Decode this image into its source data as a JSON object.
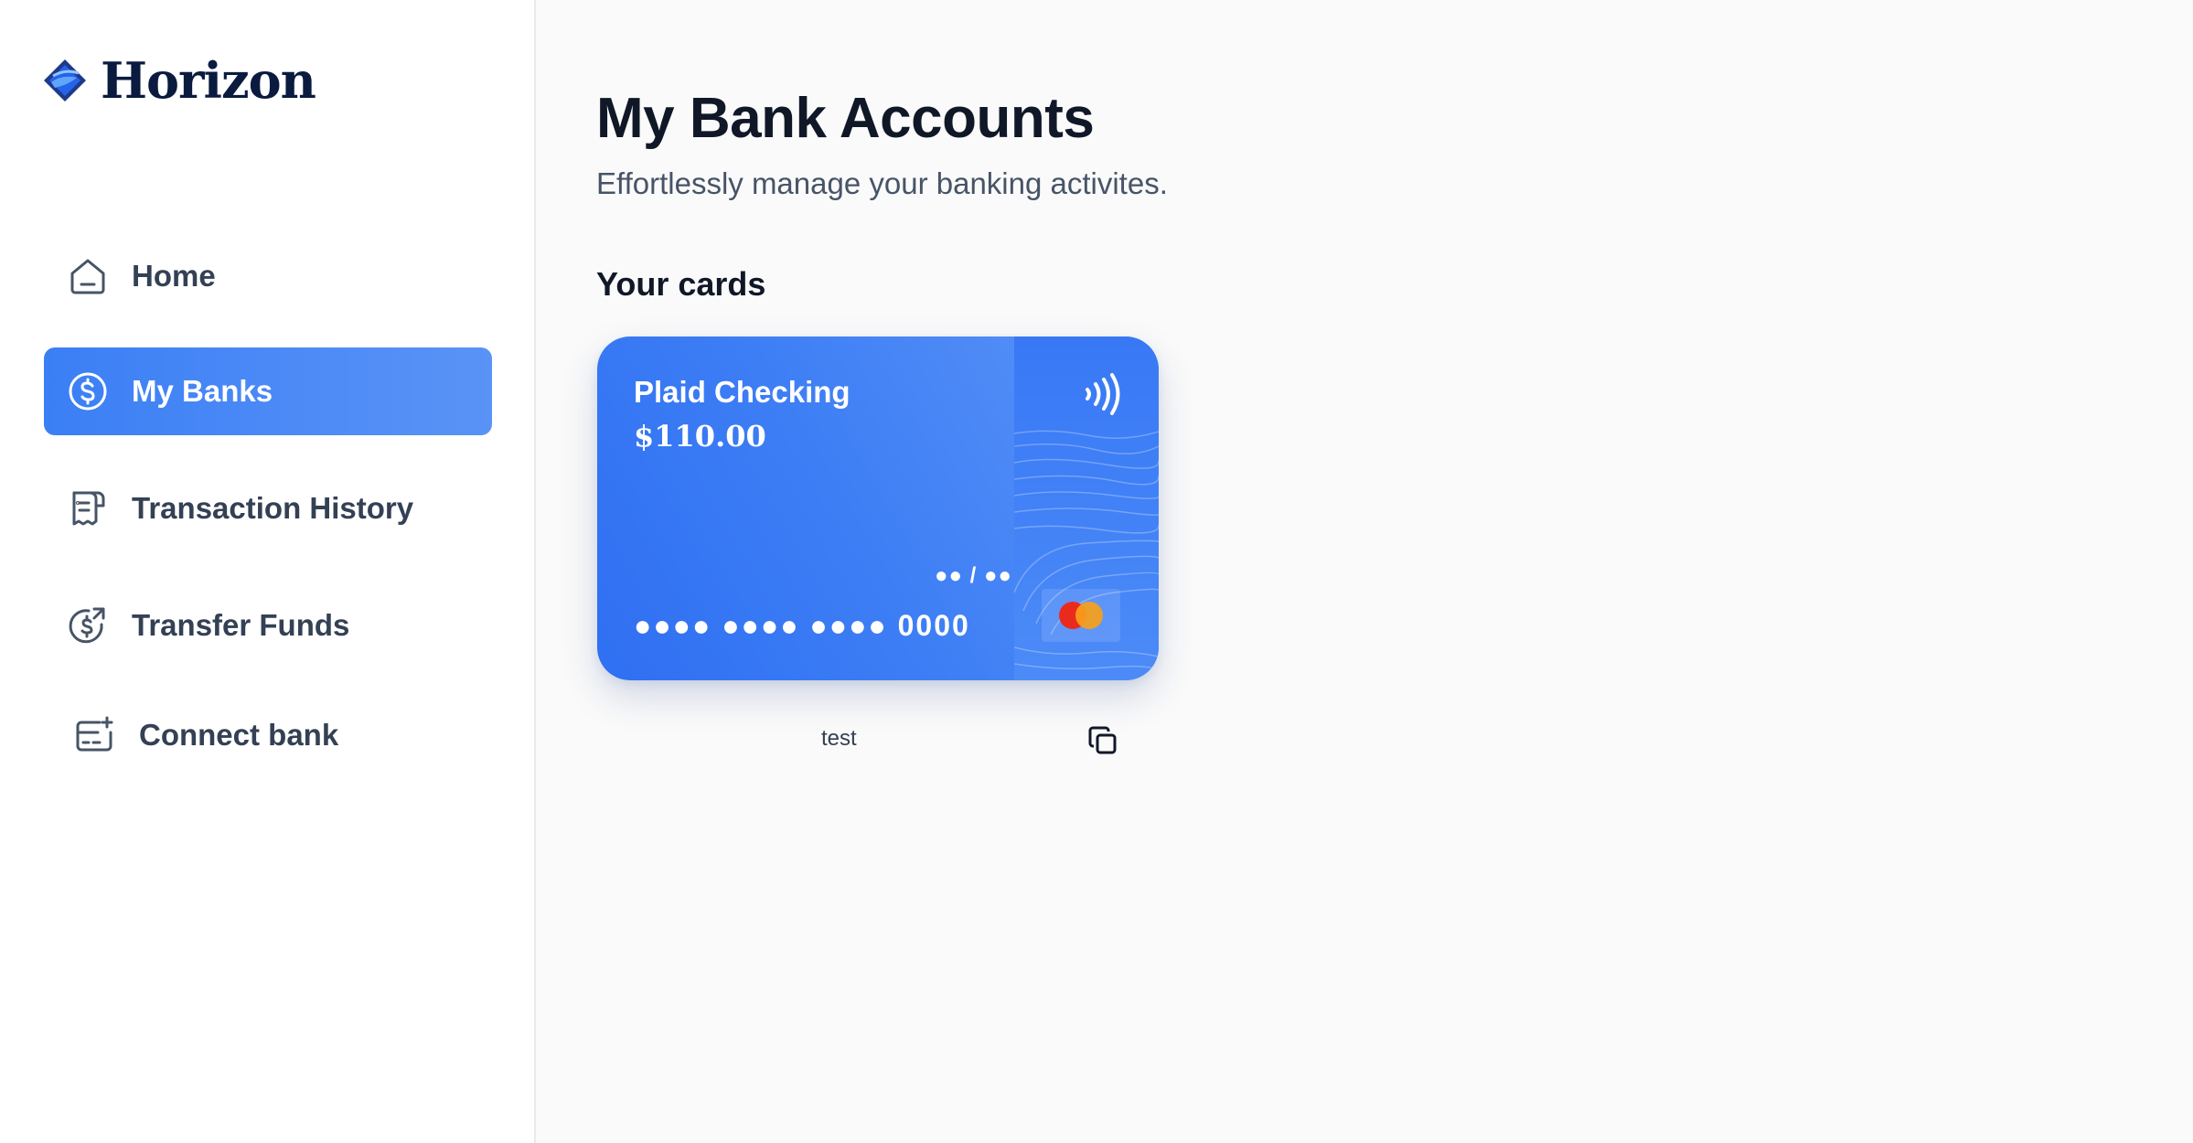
{
  "app": {
    "name": "Horizon",
    "brand_color": "#0b1b3f",
    "accent_color": "#3b7ff5",
    "logo_icon": "horizon-logo-icon"
  },
  "sidebar": {
    "items": [
      {
        "label": "Home",
        "icon": "home-icon",
        "active": false
      },
      {
        "label": "My Banks",
        "icon": "dollar-circle-icon",
        "active": true
      },
      {
        "label": "Transaction History",
        "icon": "receipt-icon",
        "active": false
      },
      {
        "label": "Transfer Funds",
        "icon": "money-send-icon",
        "active": false
      },
      {
        "label": "Connect bank",
        "icon": "card-add-icon",
        "active": false
      }
    ]
  },
  "main": {
    "title": "My Bank Accounts",
    "subtitle": "Effortlessly manage your banking activites.",
    "section_title": "Your cards",
    "cards": [
      {
        "name": "Plaid Checking",
        "balance": "$110.00",
        "expiry": "●● / ●●",
        "number": "●●●● ●●●● ●●●● 0000",
        "brand": "mastercard-logo",
        "contactless_icon": "contactless-icon",
        "footer_label": "test",
        "copy_icon": "copy-icon"
      }
    ]
  }
}
